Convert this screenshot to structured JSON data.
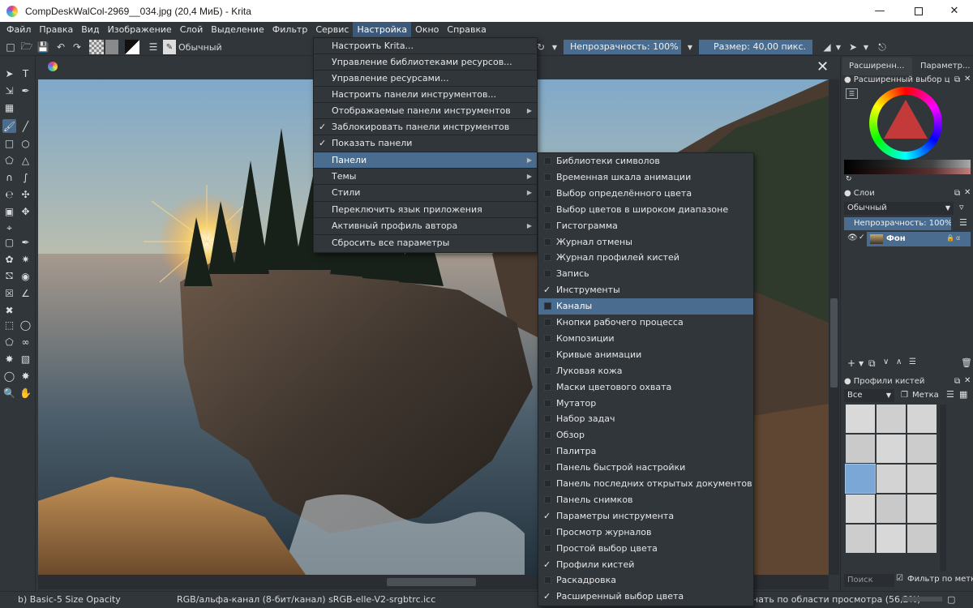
{
  "window": {
    "title": "CompDeskWalCol-2969__034.jpg (20,4 МиБ)  - Krita",
    "min_icon": "minimize-icon",
    "max_icon": "maximize-icon",
    "close_icon": "close-icon"
  },
  "menubar": [
    "Файл",
    "Правка",
    "Вид",
    "Изображение",
    "Слой",
    "Выделение",
    "Фильтр",
    "Сервис",
    "Настройка",
    "Окно",
    "Справка"
  ],
  "menubar_active": "Настройка",
  "toolbar": {
    "blend_mode": "Обычный",
    "opacity_label": "Непрозрачность: 100%",
    "size_label": "Размер: 40,00 пикс."
  },
  "settings_menu": [
    {
      "label": "Настроить Krita...",
      "check": false,
      "arrow": false
    },
    {
      "label": "Управление библиотеками ресурсов...",
      "check": false,
      "arrow": false
    },
    {
      "label": "Управление ресурсами...",
      "check": false,
      "arrow": false
    },
    {
      "label": "Настроить панели инструментов...",
      "check": false,
      "arrow": false
    },
    {
      "label": "Отображаемые панели инструментов",
      "check": false,
      "arrow": true
    },
    {
      "label": "Заблокировать панели инструментов",
      "check": true,
      "arrow": false
    },
    {
      "label": "Показать панели",
      "check": true,
      "arrow": false
    },
    {
      "label": "Панели",
      "check": false,
      "arrow": true,
      "highlighted": true
    },
    {
      "label": "Темы",
      "check": false,
      "arrow": true
    },
    {
      "label": "Стили",
      "check": false,
      "arrow": true
    },
    {
      "label": "Переключить язык приложения",
      "check": false,
      "arrow": false
    },
    {
      "label": "Активный профиль автора",
      "check": false,
      "arrow": true
    },
    {
      "label": "Сбросить все параметры",
      "check": false,
      "arrow": false
    }
  ],
  "dockers_submenu": [
    {
      "label": "Библиотеки символов",
      "check": false
    },
    {
      "label": "Временная шкала анимации",
      "check": false
    },
    {
      "label": "Выбор определённого цвета",
      "check": false
    },
    {
      "label": "Выбор цветов в широком диапазоне",
      "check": false
    },
    {
      "label": "Гистограмма",
      "check": false
    },
    {
      "label": "Журнал отмены",
      "check": false
    },
    {
      "label": "Журнал профилей кистей",
      "check": false
    },
    {
      "label": "Запись",
      "check": false
    },
    {
      "label": "Инструменты",
      "check": true
    },
    {
      "label": "Каналы",
      "check": false,
      "highlighted": true
    },
    {
      "label": "Кнопки рабочего процесса",
      "check": false
    },
    {
      "label": "Композиции",
      "check": false
    },
    {
      "label": "Кривые анимации",
      "check": false
    },
    {
      "label": "Луковая кожа",
      "check": false
    },
    {
      "label": "Маски цветового охвата",
      "check": false
    },
    {
      "label": "Мутатор",
      "check": false
    },
    {
      "label": "Набор задач",
      "check": false
    },
    {
      "label": "Обзор",
      "check": false
    },
    {
      "label": "Палитра",
      "check": false
    },
    {
      "label": "Панель быстрой настройки",
      "check": false
    },
    {
      "label": "Панель последних открытых документов",
      "check": false
    },
    {
      "label": "Панель снимков",
      "check": false
    },
    {
      "label": "Параметры инструмента",
      "check": true
    },
    {
      "label": "Просмотр журналов",
      "check": false
    },
    {
      "label": "Простой выбор цвета",
      "check": false
    },
    {
      "label": "Профили кистей",
      "check": true
    },
    {
      "label": "Раскадровка",
      "check": false
    },
    {
      "label": "Расширенный выбор цвета",
      "check": true
    }
  ],
  "dock": {
    "tab1": "Расширенн...",
    "tab2": "Параметр...",
    "color_title": "Расширенный выбор цв...",
    "layers_title": "Слои",
    "layers_blend": "Обычный",
    "layers_opacity": "Непрозрачность: 100%",
    "layer_name": "Фон",
    "brushes_title": "Профили кистей",
    "brush_filter": "Все",
    "brush_tag": "Метка",
    "search_placeholder": "Поиск",
    "filter_label": "Фильтр по метке"
  },
  "statusbar": {
    "preset": "b) Basic-5 Size Opacity",
    "colorspace": "RGB/альфа-канал (8-бит/канал)  sRGB-elle-V2-srgbtrc.icc",
    "zoom": "нать по области просмотра (56,2%)"
  },
  "colors": {
    "ui_bg": "#31363b",
    "highlight": "#4a6d8f",
    "menu_active": "#3d5a7a"
  }
}
